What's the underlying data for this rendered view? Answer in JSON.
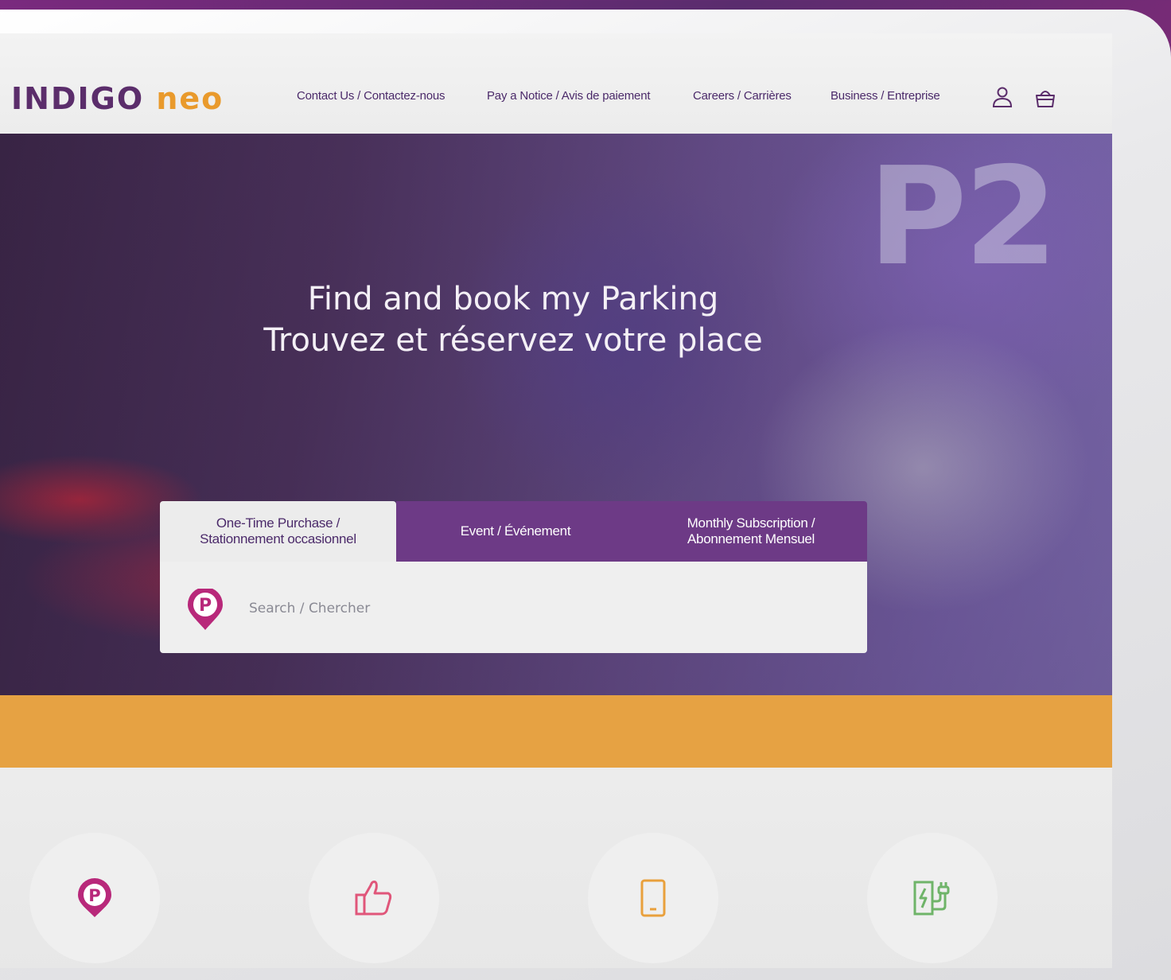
{
  "brand": {
    "logo_left": "INDIGO",
    "logo_right": "neo",
    "primary_color": "#5b2d6b",
    "accent_color": "#e99a2c"
  },
  "nav": {
    "items": [
      {
        "label": "Contact Us / Contactez-nous"
      },
      {
        "label": "Pay a Notice / Avis de paiement"
      },
      {
        "label": "Careers / Carrières"
      },
      {
        "label": "Business / Entreprise"
      }
    ],
    "icons": [
      "user-icon",
      "basket-icon"
    ]
  },
  "hero": {
    "background_sign": "P2",
    "headline_en": "Find and book my Parking",
    "headline_fr": "Trouvez et réservez votre place"
  },
  "tabs": [
    {
      "line1": "One-Time Purchase /",
      "line2": "Stationnement occasionnel",
      "active": true
    },
    {
      "line1": "Event / Événement",
      "line2": "",
      "active": false
    },
    {
      "line1": "Monthly Subscription /",
      "line2": "Abonnement Mensuel",
      "active": false
    }
  ],
  "search": {
    "placeholder": "Search / Chercher",
    "icon": "parking-pin-icon"
  },
  "band_color": "#e6a243",
  "features": [
    {
      "icon": "parking-pin-icon",
      "color": "#b8287a"
    },
    {
      "icon": "thumbs-up-icon",
      "color": "#e0567a"
    },
    {
      "icon": "smartphone-icon",
      "color": "#e9a03c"
    },
    {
      "icon": "ev-charger-icon",
      "color": "#6fb469"
    }
  ]
}
